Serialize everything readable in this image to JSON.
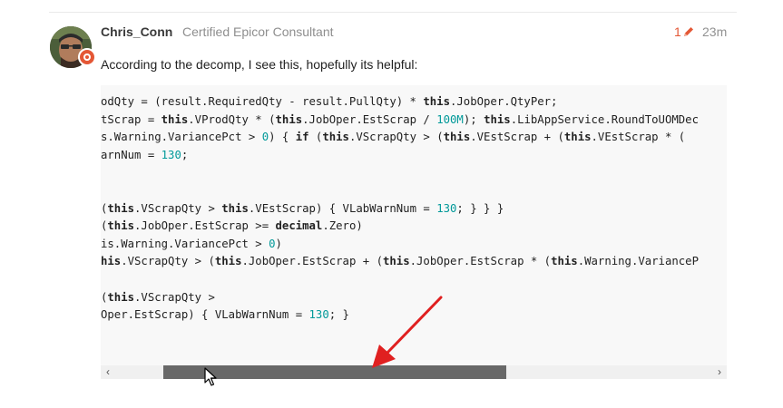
{
  "post": {
    "username": "Chris_Conn",
    "user_title": "Certified Epicor Consultant",
    "edit_count": "1",
    "time": "23m",
    "text": "According to the decomp, I see this, hopefully its helpful:"
  },
  "code_lines": [
    [
      {
        "t": "odQty = (result.RequiredQty - result.PullQty) * ",
        "c": "txt"
      },
      {
        "t": "this",
        "c": "kw"
      },
      {
        "t": ".JobOper.QtyPer;",
        "c": "txt"
      }
    ],
    [
      {
        "t": "tScrap = ",
        "c": "txt"
      },
      {
        "t": "this",
        "c": "kw"
      },
      {
        "t": ".VProdQty * (",
        "c": "txt"
      },
      {
        "t": "this",
        "c": "kw"
      },
      {
        "t": ".JobOper.EstScrap / ",
        "c": "txt"
      },
      {
        "t": "100M",
        "c": "num"
      },
      {
        "t": "); ",
        "c": "txt"
      },
      {
        "t": "this",
        "c": "kw"
      },
      {
        "t": ".LibAppService.RoundToUOMDec",
        "c": "txt"
      }
    ],
    [
      {
        "t": "s.Warning.VariancePct > ",
        "c": "txt"
      },
      {
        "t": "0",
        "c": "num"
      },
      {
        "t": ") { ",
        "c": "txt"
      },
      {
        "t": "if",
        "c": "kw"
      },
      {
        "t": " (",
        "c": "txt"
      },
      {
        "t": "this",
        "c": "kw"
      },
      {
        "t": ".VScrapQty > (",
        "c": "txt"
      },
      {
        "t": "this",
        "c": "kw"
      },
      {
        "t": ".VEstScrap + (",
        "c": "txt"
      },
      {
        "t": "this",
        "c": "kw"
      },
      {
        "t": ".VEstScrap * (",
        "c": "txt"
      }
    ],
    [
      {
        "t": "arnNum = ",
        "c": "txt"
      },
      {
        "t": "130",
        "c": "num"
      },
      {
        "t": ";",
        "c": "txt"
      }
    ],
    [],
    [],
    [
      {
        "t": "(",
        "c": "txt"
      },
      {
        "t": "this",
        "c": "kw"
      },
      {
        "t": ".VScrapQty > ",
        "c": "txt"
      },
      {
        "t": "this",
        "c": "kw"
      },
      {
        "t": ".VEstScrap) { VLabWarnNum = ",
        "c": "txt"
      },
      {
        "t": "130",
        "c": "num"
      },
      {
        "t": "; } } }",
        "c": "txt"
      }
    ],
    [
      {
        "t": "(",
        "c": "txt"
      },
      {
        "t": "this",
        "c": "kw"
      },
      {
        "t": ".JobOper.EstScrap >= ",
        "c": "txt"
      },
      {
        "t": "decimal",
        "c": "kw"
      },
      {
        "t": ".Zero)",
        "c": "txt"
      }
    ],
    [
      {
        "t": "is.Warning.VariancePct > ",
        "c": "txt"
      },
      {
        "t": "0",
        "c": "num"
      },
      {
        "t": ")",
        "c": "txt"
      }
    ],
    [
      {
        "t": "his",
        "c": "kw"
      },
      {
        "t": ".VScrapQty > (",
        "c": "txt"
      },
      {
        "t": "this",
        "c": "kw"
      },
      {
        "t": ".JobOper.EstScrap + (",
        "c": "txt"
      },
      {
        "t": "this",
        "c": "kw"
      },
      {
        "t": ".JobOper.EstScrap * (",
        "c": "txt"
      },
      {
        "t": "this",
        "c": "kw"
      },
      {
        "t": ".Warning.VarianceP",
        "c": "txt"
      }
    ],
    [],
    [
      {
        "t": "(",
        "c": "txt"
      },
      {
        "t": "this",
        "c": "kw"
      },
      {
        "t": ".VScrapQty >",
        "c": "txt"
      }
    ],
    [
      {
        "t": "Oper.EstScrap) { VLabWarnNum = ",
        "c": "txt"
      },
      {
        "t": "130",
        "c": "num"
      },
      {
        "t": "; }",
        "c": "txt"
      }
    ]
  ],
  "scrollbar": {
    "left_arrow": "‹",
    "right_arrow": "›",
    "thumb_position": 0.3
  },
  "colors": {
    "accent": "#e45735",
    "number": "#009999",
    "annotation_arrow": "#e02020"
  },
  "icons": {
    "edit": "pencil-icon",
    "flair": "flair-badge-icon",
    "cursor": "mouse-pointer-icon"
  }
}
